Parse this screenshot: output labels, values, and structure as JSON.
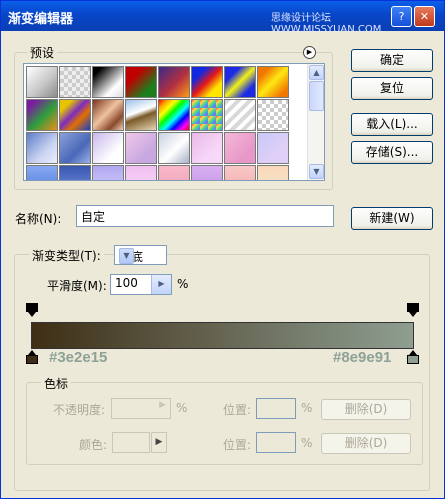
{
  "window": {
    "title": "渐变编辑器",
    "watermark": "思缘设计论坛 WWW.MISSYUAN.COM",
    "help_glyph": "?",
    "close_glyph": "✕"
  },
  "presets": {
    "label": "预设",
    "menu_icon": "triangle-right-icon",
    "swatch_names": [
      "foreground-to-background",
      "foreground-to-transparent",
      "black-white",
      "red-green",
      "violet-orange",
      "blue-red-yellow",
      "blue-yellow-blue",
      "orange-yellow-orange",
      "violet-green-orange",
      "yellow-violet-orange-blue",
      "copper",
      "chrome",
      "spectrum",
      "transparent-rainbow",
      "transparent-stripes",
      "transparent-checker",
      "blue-lavender-1",
      "blue-lavender-2",
      "lavender-1",
      "pink-lavender",
      "silver-1",
      "pink-1",
      "pink-2",
      "lavender-2",
      "blue-light",
      "blue-dark",
      "lavender-3",
      "pink-3",
      "pink-4",
      "violet-1",
      "rose-1",
      "orange-pale"
    ],
    "scroll_up": "▲",
    "scroll_down": "▼"
  },
  "buttons": {
    "ok": "确定",
    "reset": "复位",
    "load": "载入(L)...",
    "save": "存储(S)...",
    "new": "新建(W)"
  },
  "name": {
    "label": "名称(N):",
    "value": "自定"
  },
  "gradient_type": {
    "label": "渐变类型(T):",
    "value": "实底"
  },
  "smoothness": {
    "label": "平滑度(M):",
    "value": "100",
    "unit": "%"
  },
  "gradient": {
    "start_color": "#3e2e15",
    "end_color": "#8e9e91",
    "start_label": "#3e2e15",
    "end_label": "#8e9e91"
  },
  "stops": {
    "label": "色标",
    "opacity_label": "不透明度:",
    "percent": "%",
    "location_label": "位置:",
    "delete_label": "删除(D)",
    "color_label": "颜色:"
  },
  "colors": {
    "accent": "#0a5fe8",
    "button_border": "#003c74",
    "dialog_bg": "#ece9d8"
  }
}
